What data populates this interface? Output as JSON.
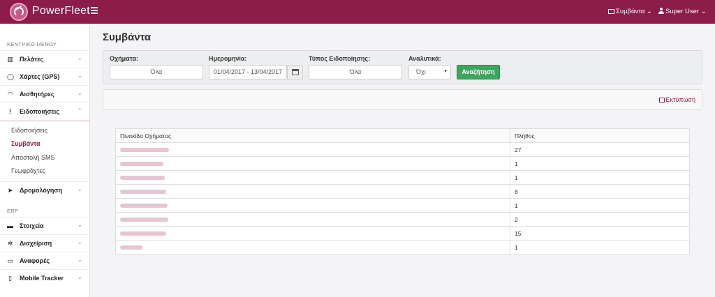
{
  "app": {
    "brand": "PowerFleet"
  },
  "header": {
    "events_label": "Συμβάντα",
    "user_label": "Super User"
  },
  "sidebar": {
    "section_main": "ΚΕΝΤΡΙΚΟ ΜΕΝΟΥ",
    "items": [
      {
        "label": "Πελάτες",
        "icon": "map-icon"
      },
      {
        "label": "Χάρτες (GPS)",
        "icon": "globe-icon"
      },
      {
        "label": "Αισθητήρες",
        "icon": "gauge-icon"
      },
      {
        "label": "Ειδοποιήσεις",
        "icon": "exclamation-icon"
      }
    ],
    "subitems": [
      "Ειδοποιήσεις",
      "Συμβάντα",
      "Αποστολή SMS",
      "Γεωφράχτες"
    ],
    "routing": {
      "label": "Δρομολόγηση",
      "icon": "location-arrow-icon"
    },
    "section_erp": "ERP",
    "erp_items": [
      {
        "label": "Στοιχεία",
        "icon": "truck-icon"
      },
      {
        "label": "Διαχείριση",
        "icon": "gear-icon"
      },
      {
        "label": "Αναφορές",
        "icon": "monitor-icon"
      },
      {
        "label": "Mobile Tracker",
        "icon": "mobile-icon"
      }
    ]
  },
  "main": {
    "title": "Συμβάντα",
    "filters": {
      "vehicles_label": "Οχήματα:",
      "vehicles_value": "Όλα",
      "date_label": "Ημερομηνία:",
      "date_value": "01/04/2017 - 13/04/2017",
      "type_label": "Τύπος Ειδοποίησης:",
      "type_value": "Όλα",
      "detail_label": "Αναλυτικά:",
      "detail_value": "Όχι",
      "search_button": "Αναζήτηση"
    },
    "print_label": "Εκτύπωση",
    "table": {
      "headers": [
        "Πινακίδα Οχήματος",
        "Πλήθος"
      ],
      "counts": [
        "27",
        "1",
        "1",
        "8",
        "1",
        "2",
        "15",
        "1"
      ]
    }
  }
}
